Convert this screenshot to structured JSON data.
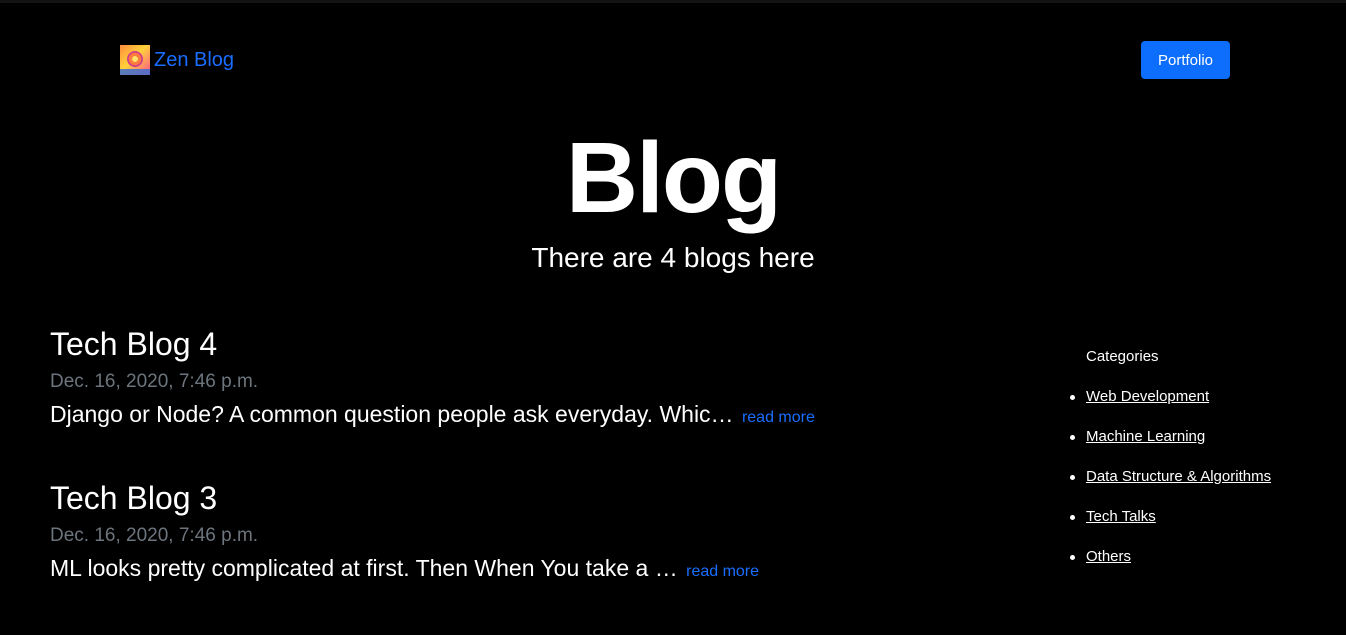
{
  "nav": {
    "brand": "Zen Blog",
    "portfolio_label": "Portfolio"
  },
  "hero": {
    "title": "Blog",
    "subtitle": "There are 4 blogs here"
  },
  "posts": [
    {
      "title": "Tech Blog 4",
      "date": "Dec. 16, 2020, 7:46 p.m.",
      "excerpt": "Django or Node? A common question people ask everyday. Whic…",
      "read_more": "read more"
    },
    {
      "title": "Tech Blog 3",
      "date": "Dec. 16, 2020, 7:46 p.m.",
      "excerpt": "ML looks pretty complicated at first. Then When You take a …",
      "read_more": "read more"
    }
  ],
  "sidebar": {
    "heading": "Categories",
    "categories": [
      "Web Development",
      "Machine Learning",
      "Data Structure & Algorithms",
      "Tech Talks",
      "Others"
    ]
  },
  "colors": {
    "background": "#000000",
    "accent": "#0d6efd",
    "link": "#1a6dff",
    "muted": "#6c757d"
  }
}
